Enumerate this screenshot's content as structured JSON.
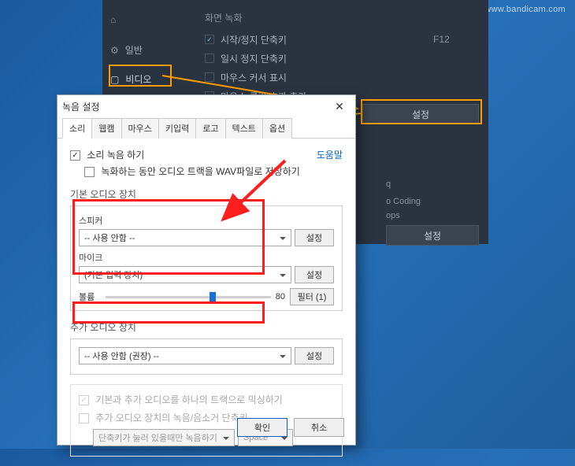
{
  "watermark": "www.bandicam.com",
  "bg": {
    "section_title": "화면 녹화",
    "sidebar": {
      "general": "일반",
      "video": "비디오"
    },
    "checks": {
      "start_stop": "시작/정지 단축키",
      "pause": "일시 정지 단축키",
      "mouse_cursor": "마우스 커서 표시",
      "mouse_effect": "마우스 클릭 효과 추가"
    },
    "keys": {
      "f12": "F12"
    },
    "info": {
      "line1": "q",
      "line2": "o Coding",
      "line3": "ops"
    },
    "btn_settings": "설정",
    "btn_settings2": "설정"
  },
  "dialog": {
    "title": "녹음 설정",
    "help": "도움말",
    "tabs": [
      "소리",
      "웹캠",
      "마우스",
      "키입력",
      "로고",
      "텍스트",
      "옵션"
    ],
    "rec_sound": "소리 녹음 하기",
    "save_wav": "녹화하는 동안 오디오 트랙을 WAV파일로 저장하기",
    "primary": {
      "title": "기본 오디오 장치",
      "speaker_label": "스피커",
      "speaker_value": "-- 사용 안함 --",
      "speaker_btn": "설정",
      "mic_label": "마이크",
      "mic_value": "(기본 입력 장치)",
      "mic_btn": "설정",
      "vol_label": "볼륨",
      "vol_value": "80",
      "filter_btn": "필터 (1)"
    },
    "secondary": {
      "title": "추가 오디오 장치",
      "value": "-- 사용 안함 (권장) --",
      "btn": "설정"
    },
    "opts": {
      "mix": "기본과 추가 오디오를 하나의 트랙으로 믹싱하기",
      "ptt": "추가 오디오 장치의 녹음/음소거 단축키",
      "ptt_mode": "단축키가 눌러 있을때만 녹음하기",
      "ptt_key": "Space"
    },
    "ok": "확인",
    "cancel": "취소"
  }
}
